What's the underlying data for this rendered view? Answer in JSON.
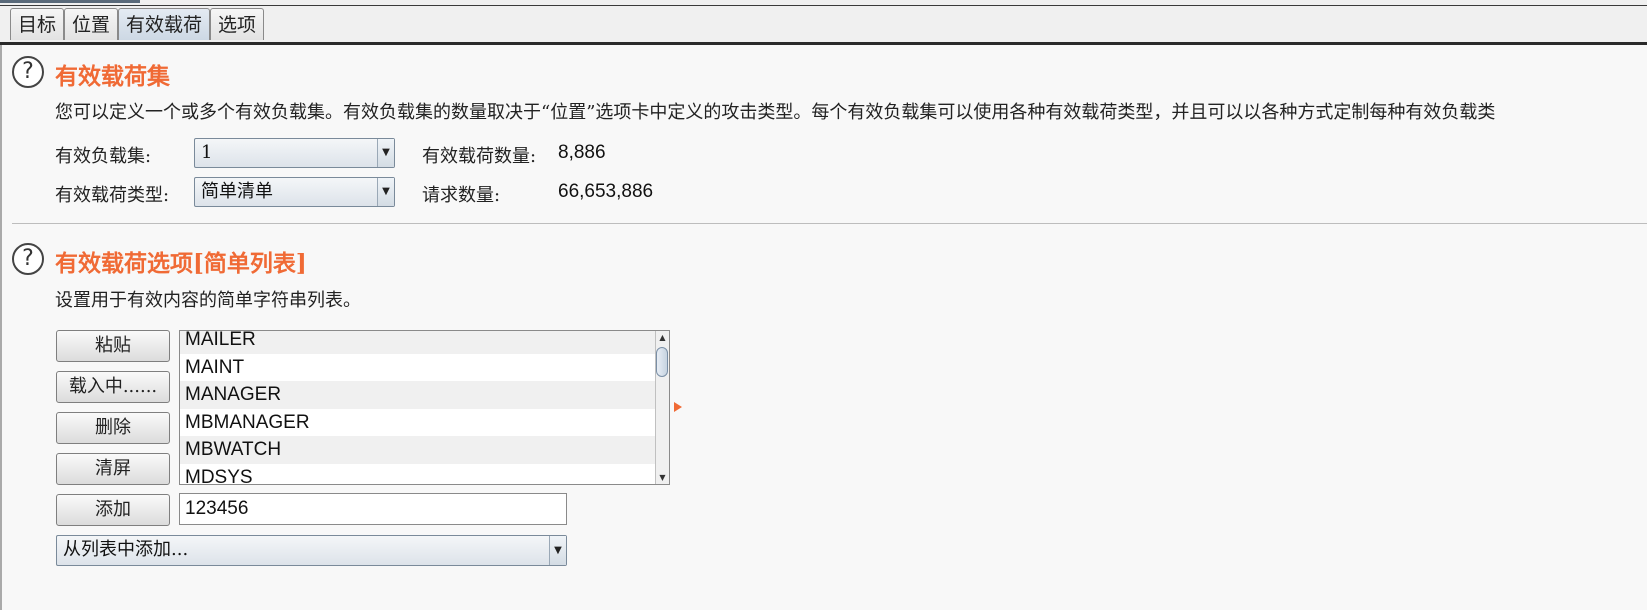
{
  "tabs": [
    {
      "label": "目标"
    },
    {
      "label": "位置"
    },
    {
      "label": "有效载荷"
    },
    {
      "label": "选项"
    }
  ],
  "payload_sets_section": {
    "title": "有效载荷集",
    "description": "您可以定义一个或多个有效负载集。有效负载集的数量取决于“位置”选项卡中定义的攻击类型。每个有效负载集可以使用各种有效载荷类型，并且可以以各种方式定制每种有效负载类",
    "payload_set_label": "有效负载集:",
    "payload_set_value": "1",
    "payload_count_label": "有效载荷数量:",
    "payload_count_value": "8,886",
    "payload_type_label": "有效载荷类型:",
    "payload_type_value": "简单清单",
    "request_count_label": "请求数量:",
    "request_count_value": "66,653,886"
  },
  "payload_options_section": {
    "title": "有效载荷选项[简单列表]",
    "description": "设置用于有效内容的简单字符串列表。",
    "buttons": {
      "paste": "粘贴",
      "load": "载入中......",
      "remove": "删除",
      "clear": "清屏",
      "add": "添加"
    },
    "list_items": [
      "MAILER",
      "MAINT",
      "MANAGER",
      "MBMANAGER",
      "MBWATCH",
      "MDSYS"
    ],
    "add_input_value": "123456",
    "add_from_list_label": "从列表中添加..."
  },
  "colors": {
    "section_title": "#f06a35",
    "active_tab": "#cdd8e4"
  }
}
